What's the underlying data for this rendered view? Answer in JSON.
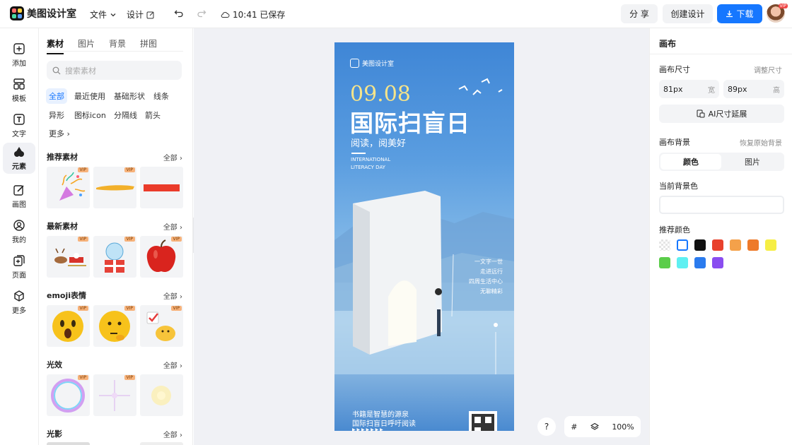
{
  "topbar": {
    "app_name": "美图设计室",
    "menu_file": "文件",
    "menu_design": "设计",
    "save_status": "10:41 已保存",
    "share_label": "分 享",
    "create_label": "创建设计",
    "download_label": "下载",
    "avatar_badge": "VIP"
  },
  "rail": {
    "items": [
      {
        "label": "添加",
        "icon": "plus-square-icon"
      },
      {
        "label": "模板",
        "icon": "template-icon"
      },
      {
        "label": "文字",
        "icon": "text-icon"
      },
      {
        "label": "元素",
        "icon": "shapes-icon"
      },
      {
        "label": "画图",
        "icon": "draw-icon"
      },
      {
        "label": "我的",
        "icon": "user-icon"
      },
      {
        "label": "页面",
        "icon": "page-add-icon"
      },
      {
        "label": "更多",
        "icon": "cube-icon"
      }
    ]
  },
  "panel": {
    "tabs": [
      "素材",
      "图片",
      "背景",
      "拼图"
    ],
    "search_placeholder": "搜索素材",
    "chips": [
      "全部",
      "最近使用",
      "基础形状",
      "线条",
      "异形",
      "图标icon",
      "分隔线",
      "箭头",
      "更多"
    ],
    "vip_label": "VIP",
    "sections": [
      {
        "title": "推荐素材",
        "all": "全部"
      },
      {
        "title": "最新素材",
        "all": "全部"
      },
      {
        "title": "emoji表情",
        "all": "全部"
      },
      {
        "title": "光效",
        "all": "全部"
      },
      {
        "title": "光影",
        "all": "全部"
      }
    ]
  },
  "poster": {
    "brand": "美图设计室",
    "date": "09.08",
    "title": "国际扫盲日",
    "subtitle": "阅读，阅美好",
    "english_1": "INTERNATIONAL",
    "english_2": "LITERACY DAY",
    "side_lines": [
      "一文字一世",
      "走进远行",
      "四周生活中心",
      "无聊精彩"
    ],
    "bottom_1": "书籍是智慧的源泉",
    "bottom_2": "国际扫盲日呼吁阅读",
    "bottom_3": "▶ ▶ ▶ ▶ ▶ ▶ ▶"
  },
  "canvas_tools": {
    "help": "?",
    "zoom": "100%"
  },
  "right": {
    "title": "画布",
    "size_label": "画布尺寸",
    "adjust_size": "调整尺寸",
    "width_value": "81px",
    "width_unit": "宽",
    "height_value": "89px",
    "height_unit": "高",
    "ai_extend": "AI尺寸延展",
    "bg_label": "画布背景",
    "restore_bg": "恢复原始背景",
    "seg_color": "颜色",
    "seg_image": "图片",
    "current_bg": "当前背景色",
    "recommend": "推荐颜色",
    "swatches": [
      "transparent",
      "#ffffff",
      "#111111",
      "#e8412c",
      "#f4a14a",
      "#ee7a2a",
      "#f6ee44",
      "#5bcd4a",
      "#5ef0f2",
      "#2b7bee",
      "#8a4df0"
    ]
  }
}
